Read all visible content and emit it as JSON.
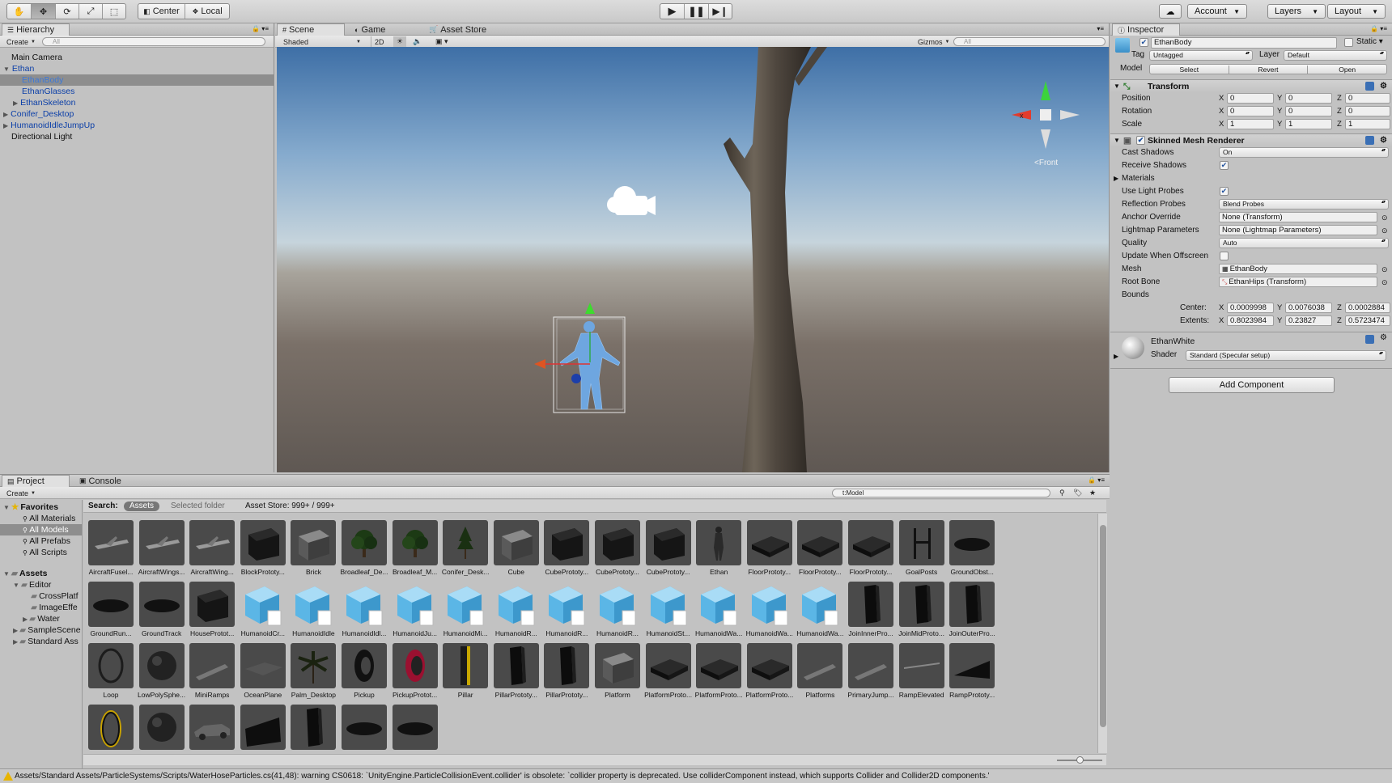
{
  "toolbar": {
    "tools": [
      "hand-icon",
      "move-icon",
      "rotate-icon",
      "scale-icon",
      "rect-icon"
    ],
    "pivot": "Center",
    "space": "Local",
    "account": "Account",
    "layers": "Layers",
    "layout": "Layout"
  },
  "hierarchy": {
    "tab": "Hierarchy",
    "create": "Create",
    "search_placeholder": "All",
    "items": [
      {
        "label": "Main Camera"
      },
      {
        "label": "Ethan"
      },
      {
        "label": "EthanBody"
      },
      {
        "label": "EthanGlasses"
      },
      {
        "label": "EthanSkeleton"
      },
      {
        "label": "Conifer_Desktop"
      },
      {
        "label": "HumanoidIdleJumpUp"
      },
      {
        "label": "Directional Light"
      }
    ]
  },
  "scene": {
    "tabs": [
      "Scene",
      "Game",
      "Asset Store"
    ],
    "shading": "Shaded",
    "mode_2d": "2D",
    "gizmos": "Gizmos",
    "search_placeholder": "All",
    "orientation": "Front",
    "gizmo_x": "x"
  },
  "inspector": {
    "tab": "Inspector",
    "object_name": "EthanBody",
    "static_label": "Static",
    "tag_label": "Tag",
    "tag_value": "Untagged",
    "layer_label": "Layer",
    "layer_value": "Default",
    "model_label": "Model",
    "model_buttons": [
      "Select",
      "Revert",
      "Open"
    ],
    "transform": {
      "title": "Transform",
      "rows": [
        {
          "label": "Position",
          "x": "0",
          "y": "0",
          "z": "0"
        },
        {
          "label": "Rotation",
          "x": "0",
          "y": "0",
          "z": "0"
        },
        {
          "label": "Scale",
          "x": "1",
          "y": "1",
          "z": "1"
        }
      ]
    },
    "renderer": {
      "title": "Skinned Mesh Renderer",
      "cast_shadows": {
        "label": "Cast Shadows",
        "value": "On"
      },
      "receive_shadows": {
        "label": "Receive Shadows",
        "checked": true
      },
      "materials": "Materials",
      "use_light_probes": {
        "label": "Use Light Probes",
        "checked": true
      },
      "reflection_probes": {
        "label": "Reflection Probes",
        "value": "Blend Probes"
      },
      "anchor_override": {
        "label": "Anchor Override",
        "value": "None (Transform)"
      },
      "lightmap_parameters": {
        "label": "Lightmap Parameters",
        "value": "None (Lightmap Parameters)"
      },
      "quality": {
        "label": "Quality",
        "value": "Auto"
      },
      "update_offscreen": {
        "label": "Update When Offscreen",
        "checked": false
      },
      "mesh": {
        "label": "Mesh",
        "value": "EthanBody"
      },
      "root_bone": {
        "label": "Root Bone",
        "value": "EthanHips (Transform)"
      },
      "bounds": "Bounds",
      "center": {
        "label": "Center:",
        "x": "0.0009998",
        "y": "0.0076038",
        "z": "0.0002884"
      },
      "extents": {
        "label": "Extents:",
        "x": "0.8023984",
        "y": "0.23827",
        "z": "0.5723474"
      }
    },
    "material": {
      "name": "EthanWhite",
      "shader_label": "Shader",
      "shader_value": "Standard (Specular setup)"
    },
    "add_component": "Add Component"
  },
  "project": {
    "tabs": [
      "Project",
      "Console"
    ],
    "create": "Create",
    "search_value": "t:Model",
    "search_label": "Search:",
    "filters": [
      "Assets",
      "Selected folder"
    ],
    "asset_store": "Asset Store: 999+ / 999+",
    "favorites_label": "Favorites",
    "favorites": [
      "All Materials",
      "All Models",
      "All Prefabs",
      "All Scripts"
    ],
    "assets_label": "Assets",
    "folders": [
      "Editor",
      "CrossPlatf",
      "ImageEffe",
      "Water",
      "SampleScene",
      "Standard Ass"
    ],
    "assets": [
      "AircraftFusel...",
      "AircraftWings...",
      "AircraftWing...",
      "BlockPrototy...",
      "Brick",
      "Broadleaf_De...",
      "Broadleaf_M...",
      "Conifer_Desk...",
      "Cube",
      "CubePrototy...",
      "CubePrototy...",
      "CubePrototy...",
      "Ethan",
      "FloorPrototy...",
      "FloorPrototy...",
      "FloorPrototy...",
      "GoalPosts",
      "GroundObst...",
      "GroundRun...",
      "GroundTrack",
      "HouseProtot...",
      "HumanoidCr...",
      "HumanoidIdle",
      "HumanoidIdl...",
      "HumanoidJu...",
      "HumanoidMi...",
      "HumanoidR...",
      "HumanoidR...",
      "HumanoidR...",
      "HumanoidSt...",
      "HumanoidWa...",
      "HumanoidWa...",
      "HumanoidWa...",
      "JoinInnerPro...",
      "JoinMidProto...",
      "JoinOuterPro...",
      "Loop",
      "LowPolySphe...",
      "MiniRamps",
      "OceanPlane",
      "Palm_Desktop",
      "Pickup",
      "PickupProtot...",
      "Pillar",
      "PillarPrototy...",
      "PillarPrototy...",
      "Platform",
      "PlatformProto...",
      "PlatformProto...",
      "PlatformProto...",
      "Platforms",
      "PrimaryJump...",
      "RampElevated",
      "RampPrototy...",
      "",
      "",
      "",
      "",
      "",
      "",
      ""
    ]
  },
  "status": "Assets/Standard Assets/ParticleSystems/Scripts/WaterHoseParticles.cs(41,48): warning CS0618: `UnityEngine.ParticleCollisionEvent.collider' is obsolete: `collider property is deprecated. Use colliderComponent instead, which supports Collider and Collider2D components.'",
  "colors": {
    "selection": "#3d7fdc",
    "link": "#0b3fa8",
    "prefab_blue": "#5bb6e6"
  }
}
